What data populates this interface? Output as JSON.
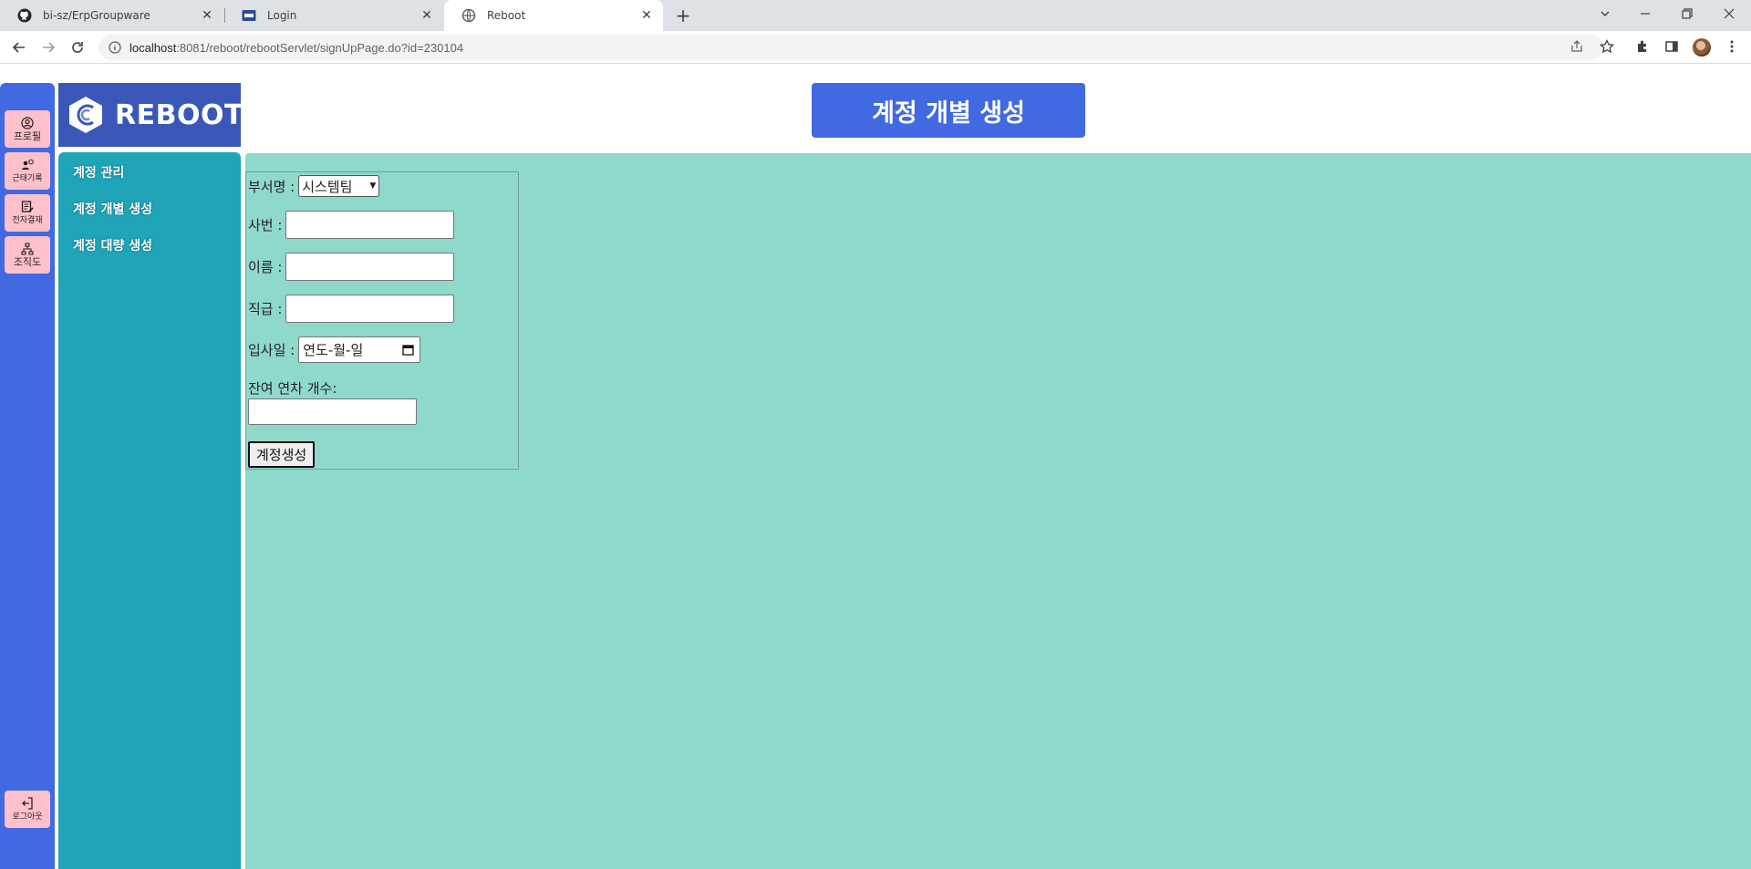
{
  "browser": {
    "tabs": [
      {
        "title": "bi-sz/ErpGroupware",
        "icon": "github-icon"
      },
      {
        "title": "Login",
        "icon": "site-icon"
      },
      {
        "title": "Reboot",
        "icon": "globe-icon",
        "active": true
      }
    ],
    "url_host": "localhost",
    "url_rest": ":8081/reboot/rebootServlet/signUpPage.do?id=230104"
  },
  "sidebar": {
    "items": [
      {
        "label": "프로필",
        "icon": "user-circle-icon"
      },
      {
        "label": "근태기록",
        "icon": "user-clock-icon"
      },
      {
        "label": "전자결재",
        "icon": "document-edit-icon"
      },
      {
        "label": "조직도",
        "icon": "org-chart-icon"
      }
    ],
    "logout": {
      "label": "로그아웃",
      "icon": "logout-icon"
    }
  },
  "brand": {
    "name": "REBOOT"
  },
  "submenu": {
    "items": [
      "계정 관리",
      "계정 개별 생성",
      "계정 대량 생성"
    ]
  },
  "header": {
    "title": "계정 개별 생성"
  },
  "form": {
    "dept_label": "부서명 :",
    "dept_selected": "시스템팀",
    "emp_no_label": "사번 :",
    "name_label": "이름 :",
    "position_label": "직급 :",
    "hire_date_label": "입사일 :",
    "hire_date_placeholder": "연도-월-일",
    "leave_label": "잔여 연차 개수:",
    "submit_label": "계정생성"
  },
  "colors": {
    "sidebar": "#4169e1",
    "submenu": "#20a4b8",
    "content": "#8fd9cb",
    "side_button": "#ffc0cb",
    "header": "#4169e1"
  }
}
